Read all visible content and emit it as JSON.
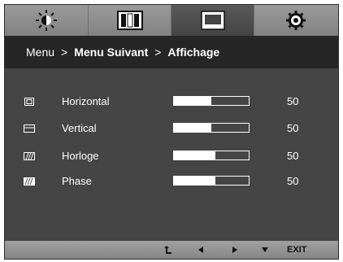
{
  "tabs": [
    {
      "icon": "brightness-icon",
      "active": false
    },
    {
      "icon": "picture-icon",
      "active": false
    },
    {
      "icon": "display-icon",
      "active": true
    },
    {
      "icon": "settings-gear-icon",
      "active": false
    }
  ],
  "breadcrumb": {
    "item1": "Menu",
    "sep1": ">",
    "item2": "Menu Suivant",
    "sep2": ">",
    "item3": "Affichage"
  },
  "settings": [
    {
      "label": "Horizontal",
      "value": "50",
      "level_percent": 50,
      "icon": "horizontal-position-icon"
    },
    {
      "label": "Vertical",
      "value": "50",
      "level_percent": 50,
      "icon": "vertical-position-icon"
    },
    {
      "label": "Horloge",
      "value": "50",
      "level_percent": 55,
      "icon": "clock-icon"
    },
    {
      "label": "Phase",
      "value": "50",
      "level_percent": 55,
      "icon": "phase-icon"
    }
  ],
  "footer": {
    "buttons": [
      "return-icon",
      "left-arrow-icon",
      "right-arrow-icon",
      "down-arrow-icon"
    ],
    "exit_label": "EXIT"
  },
  "colors": {
    "panel": "#454545",
    "breadcrumb_bar": "#262626",
    "tab_bar": "#8e8e8e",
    "text": "#ffffff"
  }
}
